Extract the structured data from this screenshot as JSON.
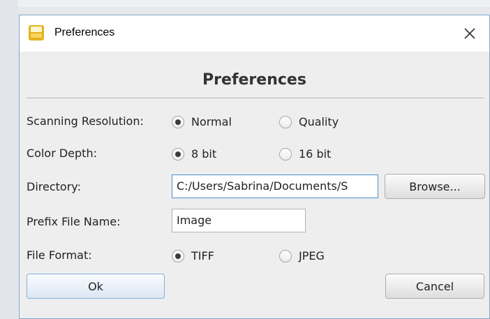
{
  "window": {
    "title": "Preferences"
  },
  "dialog": {
    "heading": "Preferences"
  },
  "fields": {
    "scanning_resolution": {
      "label": "Scanning Resolution:",
      "options": [
        "Normal",
        "Quality"
      ],
      "selected": "Normal"
    },
    "color_depth": {
      "label": "Color Depth:",
      "options": [
        "8 bit",
        "16 bit"
      ],
      "selected": "8 bit"
    },
    "directory": {
      "label": "Directory:",
      "value": "C:/Users/Sabrina/Documents/S",
      "browse_label": "Browse..."
    },
    "prefix_file_name": {
      "label": "Prefix File Name:",
      "value": "Image"
    },
    "file_format": {
      "label": "File Format:",
      "options": [
        "TIFF",
        "JPEG"
      ],
      "selected": "TIFF"
    }
  },
  "buttons": {
    "ok": "Ok",
    "cancel": "Cancel"
  },
  "colors": {
    "accent": "#4a90d0",
    "app_icon": "#e3b31f",
    "window_border": "#7fa6c9"
  },
  "icons": {
    "app": "sciview-app-icon",
    "close": "close-icon"
  }
}
